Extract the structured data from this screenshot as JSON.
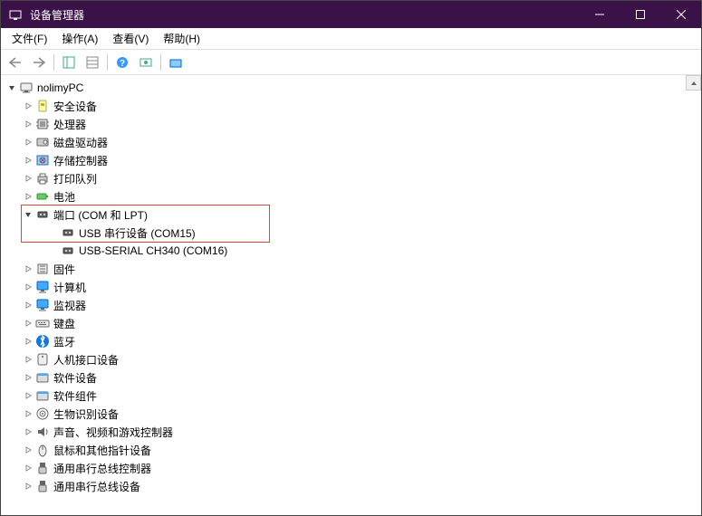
{
  "window": {
    "title": "设备管理器"
  },
  "menubar": {
    "items": [
      "文件(F)",
      "操作(A)",
      "查看(V)",
      "帮助(H)"
    ]
  },
  "toolbar": {
    "items": [
      "back",
      "forward",
      "sep",
      "show-hide-console",
      "properties",
      "sep",
      "help",
      "scan",
      "sep",
      "show-hidden"
    ]
  },
  "tree": {
    "root": {
      "label": "nolimyPC",
      "icon": "computer",
      "expanded": true
    },
    "children": [
      {
        "label": "安全设备",
        "icon": "security",
        "expanded": false
      },
      {
        "label": "处理器",
        "icon": "cpu",
        "expanded": false
      },
      {
        "label": "磁盘驱动器",
        "icon": "disk",
        "expanded": false
      },
      {
        "label": "存储控制器",
        "icon": "storage",
        "expanded": false
      },
      {
        "label": "打印队列",
        "icon": "printer",
        "expanded": false
      },
      {
        "label": "电池",
        "icon": "battery",
        "expanded": false
      },
      {
        "label": "端口 (COM 和 LPT)",
        "icon": "port",
        "expanded": true,
        "highlighted": true,
        "children": [
          {
            "label": "USB 串行设备 (COM15)",
            "icon": "port",
            "highlighted": true
          },
          {
            "label": "USB-SERIAL CH340 (COM16)",
            "icon": "port"
          }
        ]
      },
      {
        "label": "固件",
        "icon": "firmware",
        "expanded": false
      },
      {
        "label": "计算机",
        "icon": "monitor",
        "expanded": false
      },
      {
        "label": "监视器",
        "icon": "monitor",
        "expanded": false
      },
      {
        "label": "键盘",
        "icon": "keyboard",
        "expanded": false
      },
      {
        "label": "蓝牙",
        "icon": "bluetooth",
        "expanded": false
      },
      {
        "label": "人机接口设备",
        "icon": "hid",
        "expanded": false
      },
      {
        "label": "软件设备",
        "icon": "software",
        "expanded": false
      },
      {
        "label": "软件组件",
        "icon": "software",
        "expanded": false
      },
      {
        "label": "生物识别设备",
        "icon": "biometric",
        "expanded": false
      },
      {
        "label": "声音、视频和游戏控制器",
        "icon": "audio",
        "expanded": false
      },
      {
        "label": "鼠标和其他指针设备",
        "icon": "mouse",
        "expanded": false
      },
      {
        "label": "通用串行总线控制器",
        "icon": "usb",
        "expanded": false
      },
      {
        "label": "通用串行总线设备",
        "icon": "usb",
        "expanded": false
      }
    ]
  }
}
